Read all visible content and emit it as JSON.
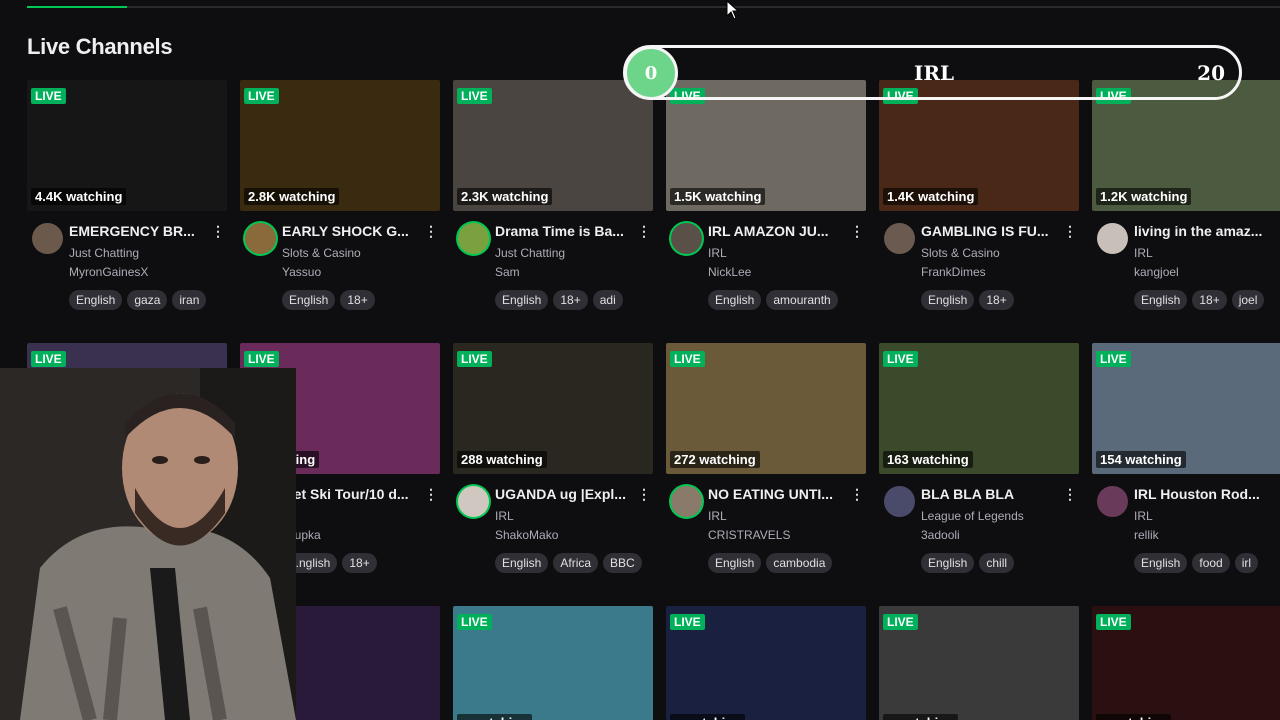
{
  "progress": 0.08,
  "page_title": "Live Channels",
  "live_badge": "LIVE",
  "irl_slider": {
    "value": "0",
    "label": "IRL",
    "max": "20"
  },
  "rows": [
    [
      {
        "viewers": "4.4K watching",
        "title": "EMERGENCY BR...",
        "category": "Just Chatting",
        "streamer": "MyronGainesX",
        "tags": [
          "English",
          "gaza",
          "iran"
        ],
        "thumb_color": "#161616",
        "avatar_color": "#6b5a4c"
      },
      {
        "viewers": "2.8K watching",
        "title": "EARLY SHOCK G...",
        "category": "Slots & Casino",
        "streamer": "Yassuo",
        "tags": [
          "English",
          "18+"
        ],
        "thumb_color": "#3a2a10",
        "avatar_color": "#8a6a3a"
      },
      {
        "viewers": "2.3K watching",
        "title": "Drama Time is Ba...",
        "category": "Just Chatting",
        "streamer": "Sam",
        "tags": [
          "English",
          "18+",
          "adi"
        ],
        "thumb_color": "#4a4540",
        "avatar_color": "#7aa040"
      },
      {
        "viewers": "1.5K watching",
        "title": "IRL AMAZON JU...",
        "category": "IRL",
        "streamer": "NickLee",
        "tags": [
          "English",
          "amouranth"
        ],
        "thumb_color": "#6e6a62",
        "avatar_color": "#5a5048"
      },
      {
        "viewers": "1.4K watching",
        "title": "GAMBLING IS FU...",
        "category": "Slots & Casino",
        "streamer": "FrankDimes",
        "tags": [
          "English",
          "18+"
        ],
        "thumb_color": "#4a2818",
        "avatar_color": "#6a5a50"
      },
      {
        "viewers": "1.2K watching",
        "title": "living in the amaz...",
        "category": "IRL",
        "streamer": "kangjoel",
        "tags": [
          "English",
          "18+",
          "joel"
        ],
        "thumb_color": "#4c5a40",
        "avatar_color": "#c8c0b8"
      }
    ],
    [
      {
        "viewers": "",
        "title": "",
        "category": "",
        "streamer": "",
        "tags": [],
        "thumb_color": "#3a3050",
        "avatar_color": "#444"
      },
      {
        "viewers": "...watching",
        "title": "...et Ski Tour/10 d...",
        "category": "",
        "streamer": "...lupka",
        "tags": [
          "...nglish",
          "18+"
        ],
        "thumb_color": "#6a2a5a",
        "avatar_color": "#444"
      },
      {
        "viewers": "288 watching",
        "title": "UGANDA ug |Expl...",
        "category": "IRL",
        "streamer": "ShakoMako",
        "tags": [
          "English",
          "Africa",
          "BBC"
        ],
        "thumb_color": "#2a2620",
        "avatar_color": "#d0c8c0"
      },
      {
        "viewers": "272 watching",
        "title": "NO EATING UNTI...",
        "category": "IRL",
        "streamer": "CRISTRAVELS",
        "tags": [
          "English",
          "cambodia"
        ],
        "thumb_color": "#6a5a3a",
        "avatar_color": "#8a7a6a"
      },
      {
        "viewers": "163 watching",
        "title": "BLA BLA BLA",
        "category": "League of Legends",
        "streamer": "3adooli",
        "tags": [
          "English",
          "chill"
        ],
        "thumb_color": "#3a4a2a",
        "avatar_color": "#4a4a6a"
      },
      {
        "viewers": "154 watching",
        "title": "IRL Houston Rod...",
        "category": "IRL",
        "streamer": "rellik",
        "tags": [
          "English",
          "food",
          "irl"
        ],
        "thumb_color": "#5a6a7a",
        "avatar_color": "#6a3a5a"
      }
    ],
    [
      {
        "viewers": "",
        "thumb_color": "#1a1a1a"
      },
      {
        "viewers": "...hing",
        "thumb_color": "#2a1a3a"
      },
      {
        "viewers": "...watching",
        "thumb_color": "#3a7a8a"
      },
      {
        "viewers": "...watching",
        "thumb_color": "#1a2040"
      },
      {
        "viewers": "...watching",
        "thumb_color": "#3a3a3a"
      },
      {
        "viewers": "...watching",
        "thumb_color": "#2a1010"
      }
    ]
  ]
}
